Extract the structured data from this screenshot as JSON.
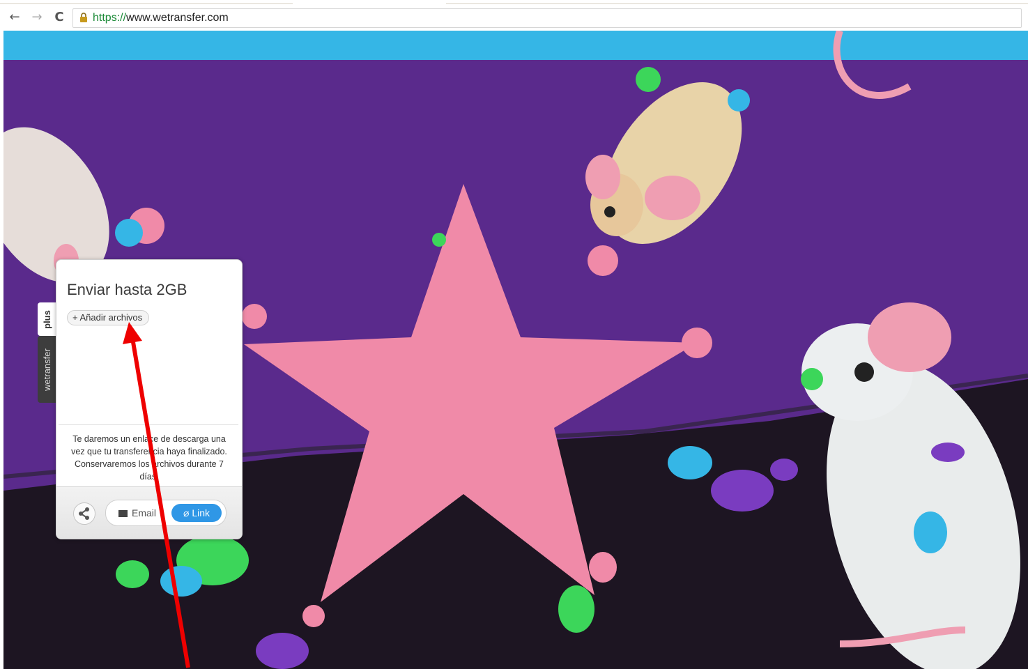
{
  "browser": {
    "url_scheme": "https://",
    "url_host": "www.wetransfer.com",
    "nav": {
      "back": "←",
      "forward": "→",
      "reload": "C"
    }
  },
  "side_tabs": {
    "plus": "plus",
    "wetransfer": "wetransfer"
  },
  "panel": {
    "title": "Enviar hasta 2GB",
    "add_files": "+ Añadir archivos",
    "info": "Te daremos un enlace de descarga una vez que tu transferencia haya finalizado. Conservaremos los archivos durante 7 días.",
    "toggle_email": "Email",
    "toggle_link": "Link"
  },
  "colors": {
    "purple_bg": "#5a2a8c",
    "cyan_top": "#35b6e6",
    "star_pink": "#f08aa8",
    "link_blue": "#2f97e6",
    "annotation_red": "#ee0000"
  }
}
